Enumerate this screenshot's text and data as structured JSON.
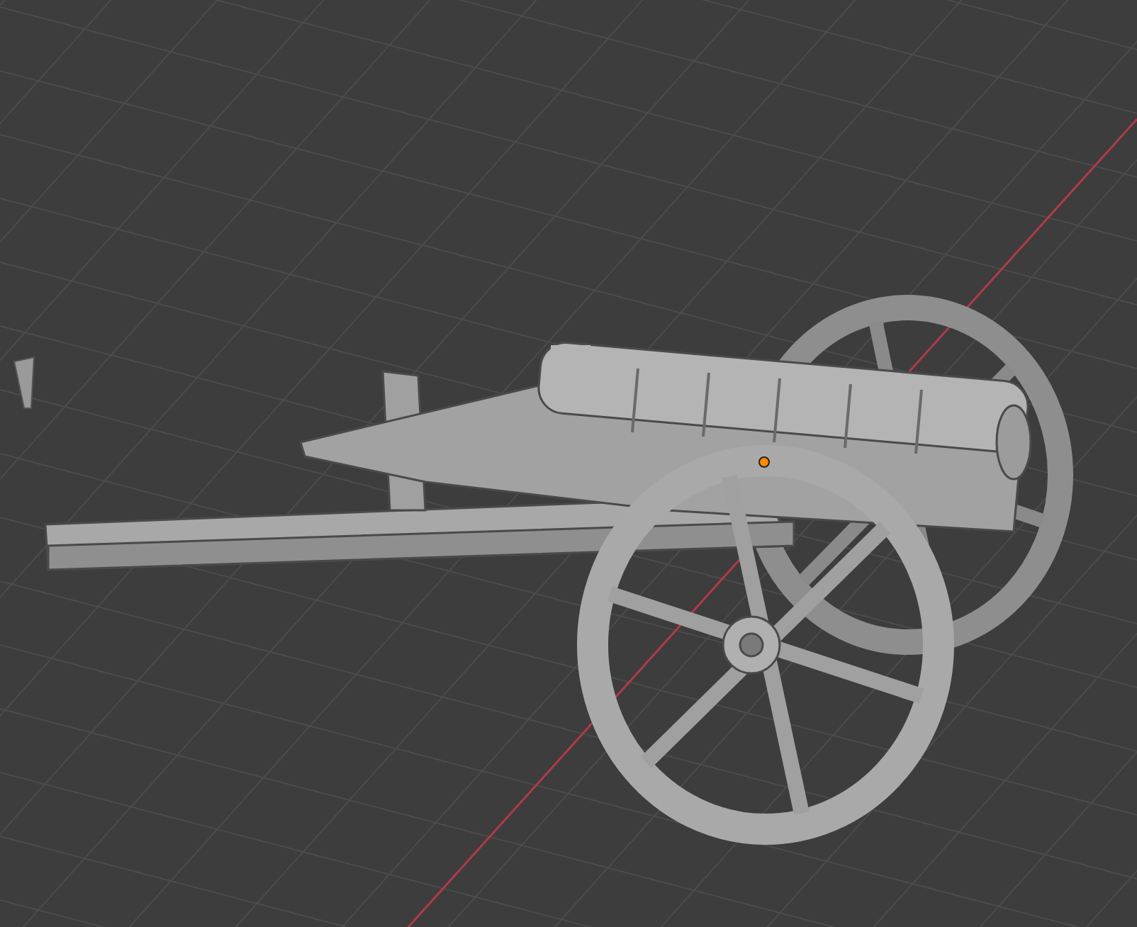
{
  "viewport": {
    "grid_visible": true,
    "axis_visible": true,
    "origin_selected": true
  }
}
